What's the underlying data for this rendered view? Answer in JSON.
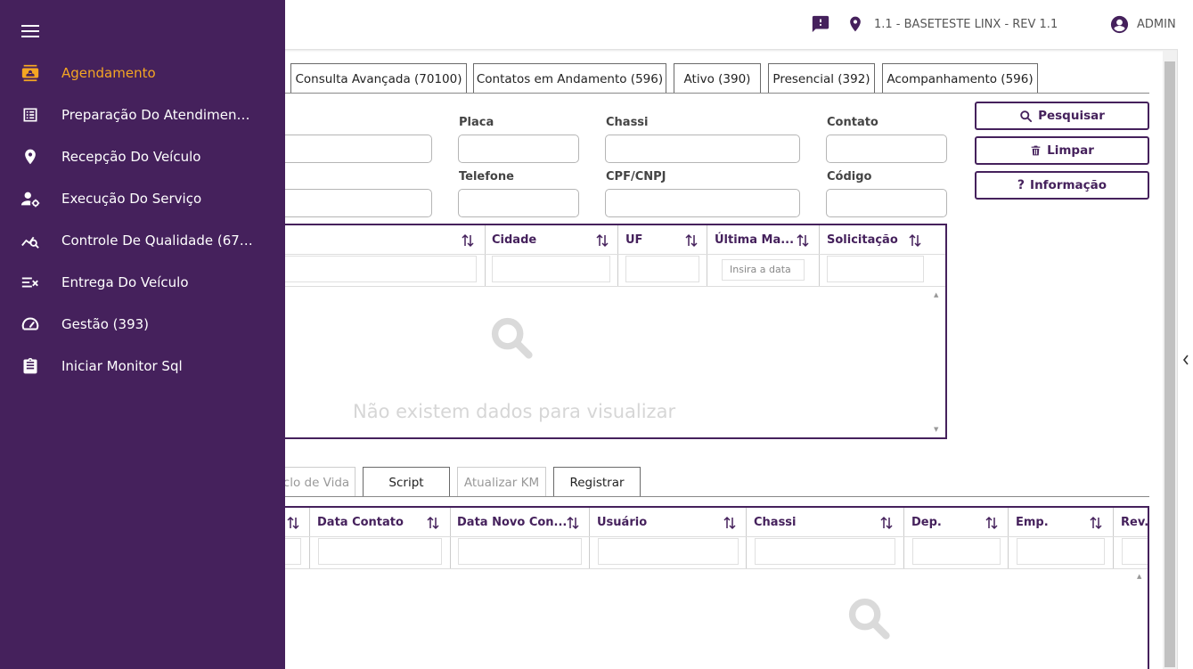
{
  "header": {
    "location": "1.1 - BASETESTE LINX - REV 1.1",
    "user": "ADMIN"
  },
  "sidebar": {
    "items": [
      {
        "label": "Agendamento",
        "active": true,
        "icon": "calendar-contact-icon"
      },
      {
        "label": "Preparação Do Atendiment...",
        "icon": "list-icon"
      },
      {
        "label": "Recepção Do Veículo",
        "icon": "location-pin-icon"
      },
      {
        "label": "Execução Do Serviço",
        "icon": "user-gear-icon"
      },
      {
        "label": "Controle De Qualidade (670)",
        "icon": "chart-search-icon"
      },
      {
        "label": "Entrega Do Veículo",
        "icon": "checklist-x-icon"
      },
      {
        "label": "Gestão (393)",
        "icon": "gauge-icon"
      },
      {
        "label": "Iniciar Monitor Sql",
        "icon": "clipboard-icon"
      }
    ]
  },
  "tabs": [
    {
      "label": "Consulta Avançada (70100)"
    },
    {
      "label": "Contatos em Andamento (596)"
    },
    {
      "label": "Ativo (390)"
    },
    {
      "label": "Presencial (392)"
    },
    {
      "label": "Acompanhamento (596)"
    }
  ],
  "form": {
    "placa": "Placa",
    "chassi": "Chassi",
    "contato": "Contato",
    "telefone": "Telefone",
    "cpf": "CPF/CNPJ",
    "codigo": "Código"
  },
  "buttons": {
    "pesquisar": "Pesquisar",
    "limpar": "Limpar",
    "informacao": "Informação"
  },
  "grid1": {
    "columns": [
      "Cidade",
      "UF",
      "Última Ma...",
      "Solicitação"
    ],
    "date_placeholder": "Insira a data",
    "empty": "Não existem dados para visualizar"
  },
  "bottom_tabs": [
    {
      "label": "clo de Vida",
      "disabled": true
    },
    {
      "label": "Script"
    },
    {
      "label": "Atualizar KM",
      "disabled": true
    },
    {
      "label": "Registrar"
    }
  ],
  "grid2": {
    "columns": [
      "Data Contato",
      "Data Novo Con...",
      "Usuário",
      "Chassi",
      "Dep.",
      "Emp.",
      "Rev."
    ]
  },
  "colors": {
    "primary": "#45215c",
    "accent": "#f5a623"
  }
}
